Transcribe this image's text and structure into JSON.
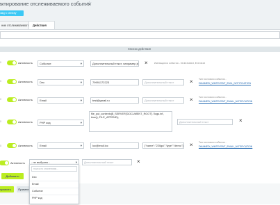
{
  "header": {
    "title": "актирование отслеживаемого события",
    "back_label": "зад к списку"
  },
  "tabs": [
    {
      "label": "ние отслеживаемого события"
    },
    {
      "label": "Действия"
    }
  ],
  "section_title": "Список действия",
  "rows": [
    {
      "num": "0",
      "toggle_label": "Активность",
      "type": "Событие",
      "value": "Дополнительный текст, например json",
      "hint": "Имеющиеся события - OrderAdded, EventList"
    },
    {
      "num": "0",
      "toggle_label": "Активность",
      "type": "Dec",
      "value": "79991172223",
      "extra_placeholder": "Дополнительный текст",
      "hint": "Тип почтового события -",
      "link": "DMAMEDI_WMTEVENT_EMIL_NOTIFICATION"
    },
    {
      "num": "0",
      "toggle_label": "Активность",
      "type": "Email",
      "value": "test@gmail.ru",
      "extra_placeholder": "Дополнительный текст",
      "hint": "Тип почтового события -",
      "link": "DMAMEDI_WMTEVENT_EMAIL_NOTIFICATION"
    },
    {
      "num": "0",
      "toggle_label": "Активность",
      "type": "PHP код",
      "code": "file_put_contents($_SERVER['DOCUMENT_ROOT'].'/logs.txt', time(), FILE_APPEND);",
      "extra_placeholder": "Дополнительный текст"
    },
    {
      "num": "0",
      "toggle_label": "Активность",
      "type": "Email",
      "value": "loc@mail.loc",
      "extra": "[\"name\":\"220ga\",\"type\":\"demo\"]",
      "hint": "Тип почтового события -",
      "link": "DMAMEDI_WMTEVENT_EMAIL_NOTIFICATION"
    },
    {
      "toggle_label": "Активность",
      "type": "- не выбрано -",
      "extra_placeholder": "Дополнительный текст"
    }
  ],
  "dropdown": {
    "search_placeholder": "поиск по значениям...",
    "options": [
      "Dec",
      "Email",
      "Событие",
      "PHP код"
    ]
  },
  "add_label": "Добавить",
  "footer": {
    "save_label": "хранить",
    "apply_label": "Примен"
  },
  "colors": {
    "accent_green": "#bbed21",
    "accent_blue": "#3bc8f5",
    "link_blue": "#2067b0"
  }
}
